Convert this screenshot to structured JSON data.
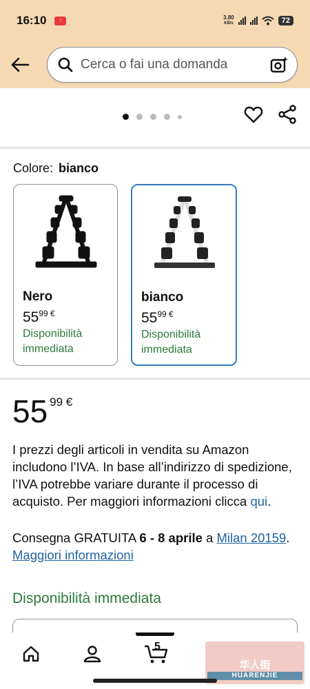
{
  "status_bar": {
    "time": "16:10",
    "net_speed_value": "3.80",
    "net_speed_unit": "KB/s",
    "battery": "72"
  },
  "search": {
    "placeholder": "Cerca o fai una domanda"
  },
  "carousel": {
    "total_dots": 5,
    "active_index": 0
  },
  "colour": {
    "label": "Colore:",
    "selected": "bianco"
  },
  "variants": [
    {
      "name": "Nero",
      "price_whole": "55",
      "price_fraction": "99 €",
      "availability": "Disponibilità immediata",
      "swatch_color": "#111111",
      "selected": false
    },
    {
      "name": "bianco",
      "price_whole": "55",
      "price_fraction": "99 €",
      "availability": "Disponibilità immediata",
      "swatch_color": "#e9e9e9",
      "selected": true
    }
  ],
  "price": {
    "whole": "55",
    "fraction": "99 €"
  },
  "vat_notice": {
    "text": "I prezzi degli articoli in vendita su Amazon includono l’IVA. In base all’indirizzo di spedizione, l’IVA potrebbe variare durante il processo di acquisto. Per maggiori informazioni clicca ",
    "link": "qui",
    "suffix": "."
  },
  "delivery": {
    "prefix": "Consegna GRATUITA ",
    "dates": "6 - 8 aprile",
    "middle": " a ",
    "location": "Milan 20159",
    "separator": ". ",
    "more_link": "Maggiori informazioni"
  },
  "availability": {
    "heading": "Disponibilità immediata"
  },
  "bottom_nav": {
    "cart_count": "5",
    "watermark_text": "华人街",
    "watermark_band": "HUARENJIE"
  },
  "colors": {
    "header_bg": "#f5d9b3",
    "link": "#2162a1",
    "in_stock_green": "#2b7a3a",
    "selected_border": "#2f7bbf"
  }
}
